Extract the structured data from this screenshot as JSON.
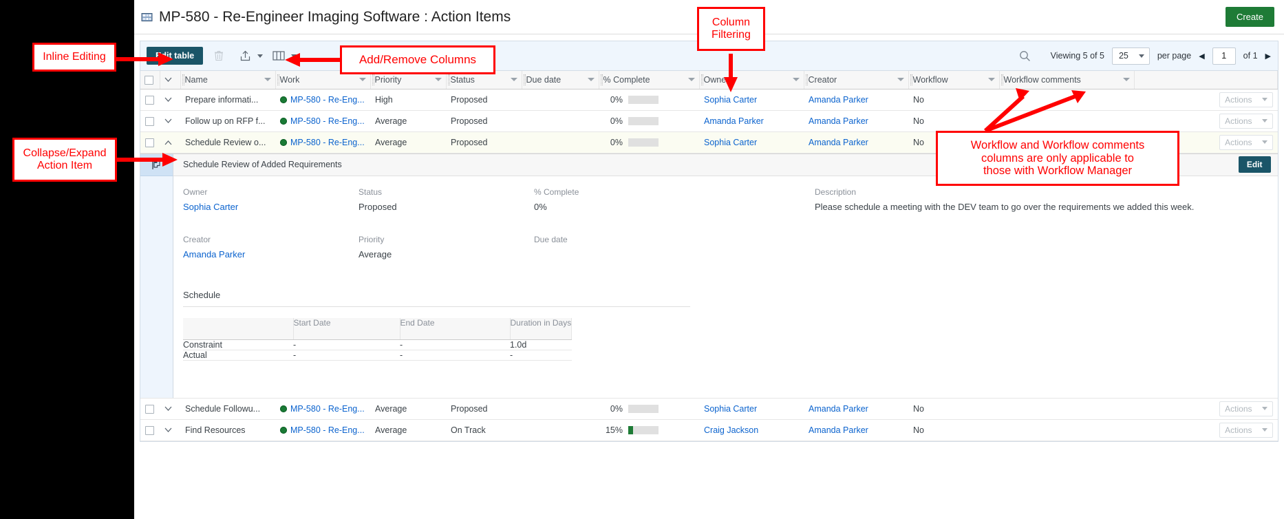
{
  "header": {
    "title": "MP-580 - Re-Engineer Imaging Software : Action Items",
    "title_icon": "project-icon",
    "create_label": "Create"
  },
  "toolbar": {
    "edit_table_label": "Edit table",
    "delete_icon": "trash-icon",
    "export_icon": "export-icon",
    "columns_icon": "columns-icon",
    "search_icon": "search-icon",
    "viewing_text": "Viewing 5 of 5",
    "viewing_prefix": "Viewing ",
    "viewing_count": "5 of 5",
    "per_page_value": "25",
    "per_page_label": "per page",
    "page_value": "1",
    "of_pages": "of 1",
    "prev_arrow": "prev-page-arrow",
    "next_arrow": "next-page-arrow"
  },
  "table": {
    "columns": [
      {
        "key": "name",
        "label": "Name"
      },
      {
        "key": "work",
        "label": "Work"
      },
      {
        "key": "priority",
        "label": "Priority"
      },
      {
        "key": "status",
        "label": "Status"
      },
      {
        "key": "due_date",
        "label": "Due date"
      },
      {
        "key": "pct_complete",
        "label": "% Complete"
      },
      {
        "key": "owner",
        "label": "Owner"
      },
      {
        "key": "creator",
        "label": "Creator"
      },
      {
        "key": "workflow",
        "label": "Workflow"
      },
      {
        "key": "workflow_comments",
        "label": "Workflow comments"
      }
    ],
    "actions_label": "Actions",
    "rows": [
      {
        "name": "Prepare informati...",
        "work": "MP-580 - Re-Eng...",
        "priority": "High",
        "status": "Proposed",
        "due_date": "",
        "pct_complete": "0%",
        "pct_value": 0,
        "owner": "Sophia Carter",
        "creator": "Amanda Parker",
        "workflow": "No",
        "workflow_comments": "",
        "expanded": false,
        "selected": false
      },
      {
        "name": "Follow up on RFP f...",
        "work": "MP-580 - Re-Eng...",
        "priority": "Average",
        "status": "Proposed",
        "due_date": "",
        "pct_complete": "0%",
        "pct_value": 0,
        "owner": "Amanda Parker",
        "creator": "Amanda Parker",
        "workflow": "No",
        "workflow_comments": "",
        "expanded": false,
        "selected": false
      },
      {
        "name": "Schedule Review o...",
        "work": "MP-580 - Re-Eng...",
        "priority": "Average",
        "status": "Proposed",
        "due_date": "",
        "pct_complete": "0%",
        "pct_value": 0,
        "owner": "Sophia Carter",
        "creator": "Amanda Parker",
        "workflow": "No",
        "workflow_comments": "",
        "expanded": true,
        "selected": true
      },
      {
        "name": "Schedule Followu...",
        "work": "MP-580 - Re-Eng...",
        "priority": "Average",
        "status": "Proposed",
        "due_date": "",
        "pct_complete": "0%",
        "pct_value": 0,
        "owner": "Sophia Carter",
        "creator": "Amanda Parker",
        "workflow": "No",
        "workflow_comments": "",
        "expanded": false,
        "selected": false
      },
      {
        "name": "Find Resources",
        "work": "MP-580 - Re-Eng...",
        "priority": "Average",
        "status": "On Track",
        "due_date": "",
        "pct_complete": "15%",
        "pct_value": 15,
        "owner": "Craig Jackson",
        "creator": "Amanda Parker",
        "workflow": "No",
        "workflow_comments": "",
        "expanded": false,
        "selected": false
      }
    ]
  },
  "detail": {
    "flag_icon": "flag-icon",
    "heading": "Schedule Review of Added Requirements",
    "edit_label": "Edit",
    "fields": {
      "owner_label": "Owner",
      "owner_value": "Sophia Carter",
      "status_label": "Status",
      "status_value": "Proposed",
      "pct_label": "% Complete",
      "pct_value": "0%",
      "creator_label": "Creator",
      "creator_value": "Amanda Parker",
      "priority_label": "Priority",
      "priority_value": "Average",
      "due_label": "Due date",
      "due_value": "",
      "description_label": "Description",
      "description_value": "Please schedule a meeting with the DEV team to go over the requirements we added this week."
    },
    "schedule": {
      "title": "Schedule",
      "headers": [
        "",
        "Start Date",
        "End Date",
        "Duration in Days"
      ],
      "rows": [
        {
          "label": "Constraint",
          "start": "-",
          "end": "-",
          "duration": "1.0d"
        },
        {
          "label": "Actual",
          "start": "-",
          "end": "-",
          "duration": "-"
        }
      ]
    }
  },
  "annotations": [
    {
      "id": "inline-editing",
      "text": "Inline Editing"
    },
    {
      "id": "collapse-expand",
      "text": "Collapse/Expand\nAction Item"
    },
    {
      "id": "add-remove-columns",
      "text": "Add/Remove Columns"
    },
    {
      "id": "column-filtering",
      "text": "Column\nFiltering"
    },
    {
      "id": "workflow-note",
      "text": "Workflow and Workflow comments\ncolumns are only applicable to\nthose with Workflow Manager"
    }
  ],
  "colors": {
    "accent_teal": "#1a5568",
    "create_green": "#1e7b36",
    "link_blue": "#0b63ce",
    "annotation_red": "#ff0000",
    "toolbar_bg": "#eff6fd"
  }
}
